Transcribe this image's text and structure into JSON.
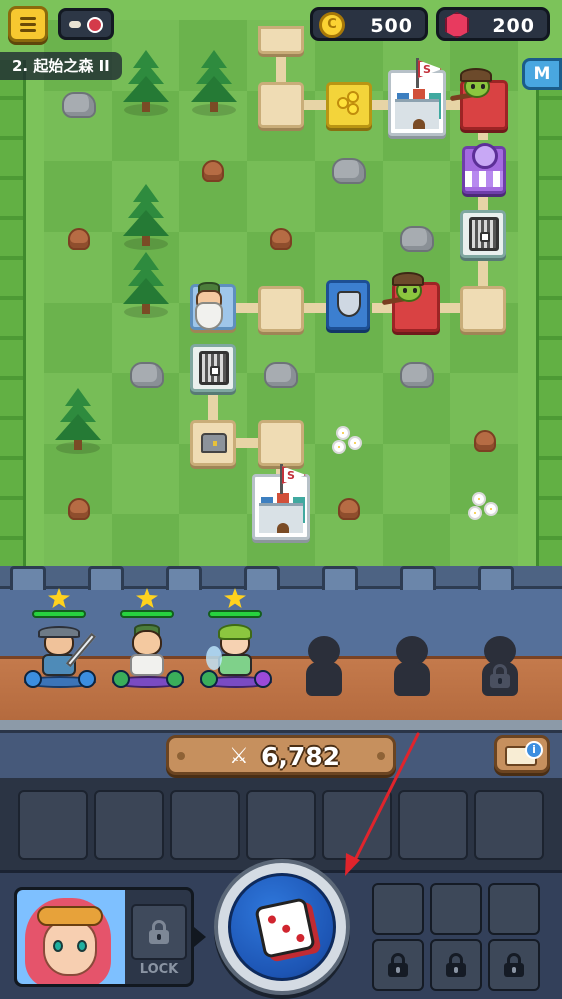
{
  "hud": {
    "gold": "500",
    "gold_icon": "C",
    "gems": "200",
    "stage": "2. 起始之森 II",
    "map_button": "M"
  },
  "board": {
    "castle_flag": "S"
  },
  "party": {
    "heroes": [
      {
        "name": "knight",
        "stars": 1,
        "hp_fraction": 1.0
      },
      {
        "name": "sage",
        "stars": 1,
        "hp_fraction": 1.0
      },
      {
        "name": "elf-archer",
        "stars": 1,
        "hp_fraction": 1.0
      }
    ],
    "empty_slots": 3
  },
  "power": {
    "swords_glyph": "⚔",
    "value": "6,782",
    "info_glyph": "i"
  },
  "inventory": {
    "slot_count": 7
  },
  "bottom": {
    "lock_label": "LOCK"
  },
  "colors": {
    "arrow": "#e0242c",
    "gold": "#fbd233",
    "gem": "#e83a5f"
  }
}
